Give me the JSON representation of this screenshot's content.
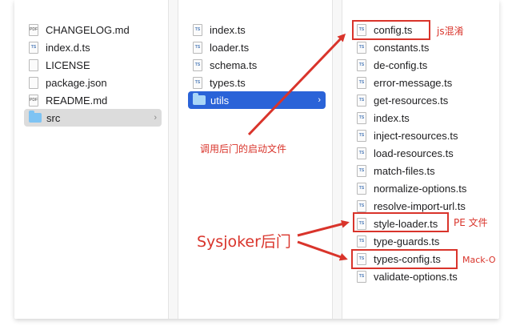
{
  "column1": {
    "items": [
      {
        "name": "CHANGELOG.md",
        "icon": "document-icon",
        "icon_text": "PDF"
      },
      {
        "name": "index.d.ts",
        "icon": "ts-file-icon",
        "icon_text": "TS"
      },
      {
        "name": "LICENSE",
        "icon": "blank-file-icon",
        "icon_text": ""
      },
      {
        "name": "package.json",
        "icon": "blank-file-icon",
        "icon_text": ""
      },
      {
        "name": "README.md",
        "icon": "document-icon",
        "icon_text": "PDF"
      },
      {
        "name": "src",
        "icon": "folder-icon",
        "chevron": "›"
      }
    ]
  },
  "column2": {
    "items": [
      {
        "name": "index.ts",
        "icon_text": "TS"
      },
      {
        "name": "loader.ts",
        "icon_text": "TS"
      },
      {
        "name": "schema.ts",
        "icon_text": "TS"
      },
      {
        "name": "types.ts",
        "icon_text": "TS"
      },
      {
        "name": "utils",
        "chevron": "›"
      }
    ]
  },
  "column3": {
    "items": [
      {
        "name": "config.ts",
        "icon_text": "TS"
      },
      {
        "name": "constants.ts",
        "icon_text": "TS"
      },
      {
        "name": "de-config.ts",
        "icon_text": "TS"
      },
      {
        "name": "error-message.ts",
        "icon_text": "TS"
      },
      {
        "name": "get-resources.ts",
        "icon_text": "TS"
      },
      {
        "name": "index.ts",
        "icon_text": "TS"
      },
      {
        "name": "inject-resources.ts",
        "icon_text": "TS"
      },
      {
        "name": "load-resources.ts",
        "icon_text": "TS"
      },
      {
        "name": "match-files.ts",
        "icon_text": "TS"
      },
      {
        "name": "normalize-options.ts",
        "icon_text": "TS"
      },
      {
        "name": "resolve-import-url.ts",
        "icon_text": "TS"
      },
      {
        "name": "style-loader.ts",
        "icon_text": "TS"
      },
      {
        "name": "type-guards.ts",
        "icon_text": "TS"
      },
      {
        "name": "types-config.ts",
        "icon_text": "TS"
      },
      {
        "name": "validate-options.ts",
        "icon_text": "TS"
      }
    ]
  },
  "annotations": {
    "js_obfuscation": "js混淆",
    "backdoor_launcher": "调用后门的启动文件",
    "pe_file": "PE 文件",
    "sysjoker": "Sysjoker后门",
    "macho": "Mack-O"
  },
  "colors": {
    "selection_blue": "#2a63d8",
    "selection_grey": "#dcdcdc",
    "annotation_red": "#d9342b",
    "folder_blue": "#7ec3f3"
  }
}
